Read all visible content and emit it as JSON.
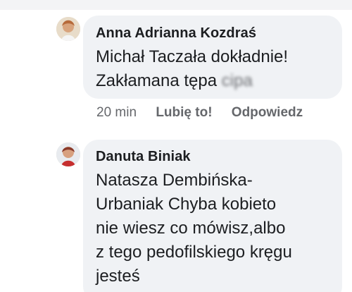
{
  "comments": [
    {
      "author": "Anna Adrianna Kozdraś",
      "line1": "Michał Taczała  dokładnie!",
      "line2_visible": "Zakłamana tępa",
      "line2_obscured": "cipa",
      "time": "20 min",
      "like_label": "Lubię to!",
      "reply_label": "Odpowiedz"
    },
    {
      "author": "Danuta Biniak",
      "lines": [
        "Natasza Dembińska-",
        "Urbaniak Chyba kobieto",
        "nie wiesz co mówisz,albo",
        "z tego pedofilskiego kręgu",
        "jesteś"
      ]
    }
  ],
  "colors": {
    "bubble": "#f0f2f5",
    "text": "#1c1e21",
    "meta": "#65676b"
  }
}
